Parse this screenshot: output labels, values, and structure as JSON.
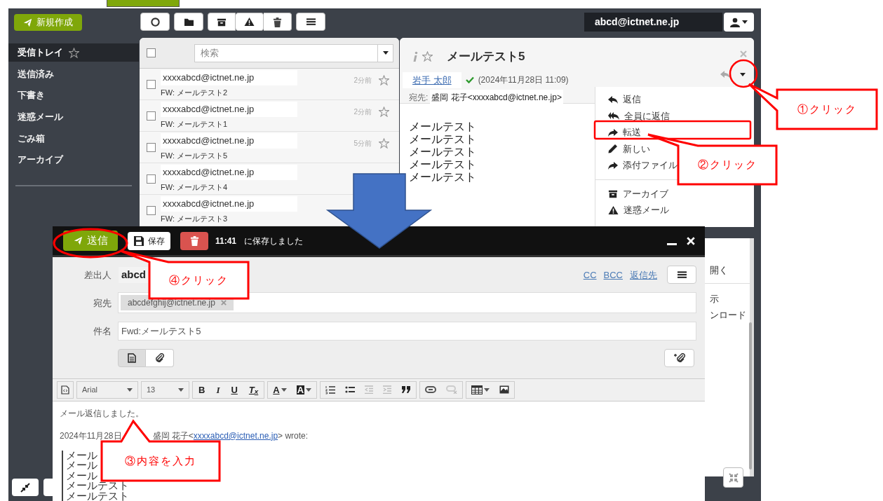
{
  "compose_button": {
    "label": "新規作成"
  },
  "account": {
    "email": "abcd@ictnet.ne.jp"
  },
  "sidebar": {
    "items": [
      {
        "label": "受信トレイ",
        "selected": true
      },
      {
        "label": "送信済み",
        "selected": false
      },
      {
        "label": "下書き",
        "selected": false
      },
      {
        "label": "迷惑メール",
        "selected": false
      },
      {
        "label": "ごみ箱",
        "selected": false
      },
      {
        "label": "アーカイブ",
        "selected": false
      }
    ]
  },
  "message_list": {
    "search_placeholder": "検索",
    "select_all_checked": false,
    "rows": [
      {
        "sender": "xxxxabcd@ictnet.ne.jp",
        "subject": "FW: メールテスト2",
        "time": "2分前",
        "checked": false,
        "starred": false
      },
      {
        "sender": "xxxxabcd@ictnet.ne.jp",
        "subject": "FW: メールテスト1",
        "time": "2分前",
        "checked": false,
        "starred": false
      },
      {
        "sender": "xxxxabcd@ictnet.ne.jp",
        "subject": "FW: メールテスト5",
        "time": "5分前",
        "checked": false,
        "starred": false
      },
      {
        "sender": "xxxxabcd@ictnet.ne.jp",
        "subject": "FW: メールテスト4",
        "checked": false
      },
      {
        "sender": "xxxxabcd@ictnet.ne.jp",
        "subject": "FW: メールテスト3",
        "checked": false
      }
    ]
  },
  "reading_pane": {
    "title": "メールテスト5",
    "starred": false,
    "sender": "岩手 太郎",
    "date": "(2024年11月28日 11:09)",
    "to_label": "宛先:",
    "to": "盛岡 花子<xxxxabcd@ictnet.ne.jp>",
    "body": [
      "メールテスト",
      "メールテスト",
      "メールテスト",
      "メールテスト",
      "メールテスト"
    ]
  },
  "action_menu": {
    "groups": [
      [
        {
          "label": "返信"
        },
        {
          "label": "全員に返信"
        },
        {
          "label": "転送"
        },
        {
          "label": "新しい"
        },
        {
          "label": "添付ファイル"
        }
      ],
      [
        {
          "label": "アーカイブ"
        },
        {
          "label": "迷惑メール"
        }
      ]
    ],
    "fragments": [
      "開く",
      "示",
      "ンロード"
    ]
  },
  "compose": {
    "send": "送信",
    "save": "保存",
    "saved_time": "11:41",
    "saved_text": "に保存しました",
    "from_label": "差出人",
    "from": "abcd",
    "links": [
      "CC",
      "BCC",
      "返信先"
    ],
    "to_label": "宛先",
    "recipients": [
      "abcdefghij@ictnet.ne.jp"
    ],
    "subject_label": "件名",
    "subject": "Fwd:メールテスト5",
    "font": "Arial",
    "size": "13",
    "format_buttons": [
      "B",
      "I",
      "U",
      "T$_{x}$"
    ],
    "color_buttons": [
      "A",
      "A"
    ],
    "body": {
      "text": "メール返信しました。",
      "quote_date": "2024年11月28日",
      "quote_name": "盛岡 花子<",
      "quote_email": "xxxxabcd@ictnet.ne.jp",
      "quote_suffix": "> wrote:",
      "quoted_lines": [
        "メール",
        "メール",
        "メール",
        "メールテスト",
        "メールテスト"
      ]
    }
  },
  "annotations": [
    {
      "text": "①クリック"
    },
    {
      "text": "②クリック"
    },
    {
      "text": "③内容を入力"
    },
    {
      "text": "④クリック"
    }
  ]
}
